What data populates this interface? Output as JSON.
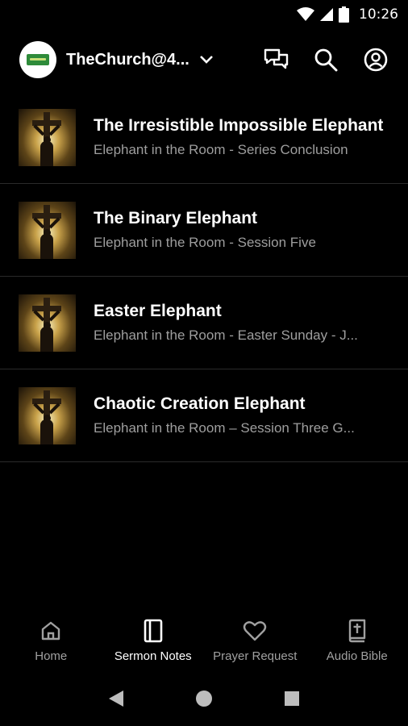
{
  "status_bar": {
    "time": "10:26",
    "icons": [
      "wifi-icon",
      "cellular-signal-icon",
      "battery-icon"
    ]
  },
  "app_bar": {
    "church_name": "TheChurch@4...",
    "actions": [
      "chat-icon",
      "search-icon",
      "account-icon"
    ]
  },
  "sermons": [
    {
      "title": "The Irresistible Impossible Elephant",
      "subtitle": "Elephant in the Room - Series Conclusion"
    },
    {
      "title": "The Binary Elephant",
      "subtitle": "Elephant in the Room - Session Five"
    },
    {
      "title": "Easter Elephant",
      "subtitle": "Elephant in the Room - Easter Sunday - J..."
    },
    {
      "title": "Chaotic Creation Elephant",
      "subtitle": "Elephant in the Room – Session Three G..."
    }
  ],
  "bottom_nav": {
    "active": "Sermon Notes",
    "items": [
      {
        "label": "Home",
        "icon": "home-icon"
      },
      {
        "label": "Sermon Notes",
        "icon": "notebook-icon"
      },
      {
        "label": "Prayer Request",
        "icon": "heart-icon"
      },
      {
        "label": "Audio Bible",
        "icon": "bible-icon"
      }
    ]
  },
  "system_nav": [
    "back-icon",
    "home-circle-icon",
    "recents-icon"
  ],
  "colors": {
    "background": "#000000",
    "primary_text": "#ffffff",
    "secondary_text": "#9e9e9e",
    "inactive_nav": "#a0a0a0",
    "divider": "#2a2a2a"
  }
}
